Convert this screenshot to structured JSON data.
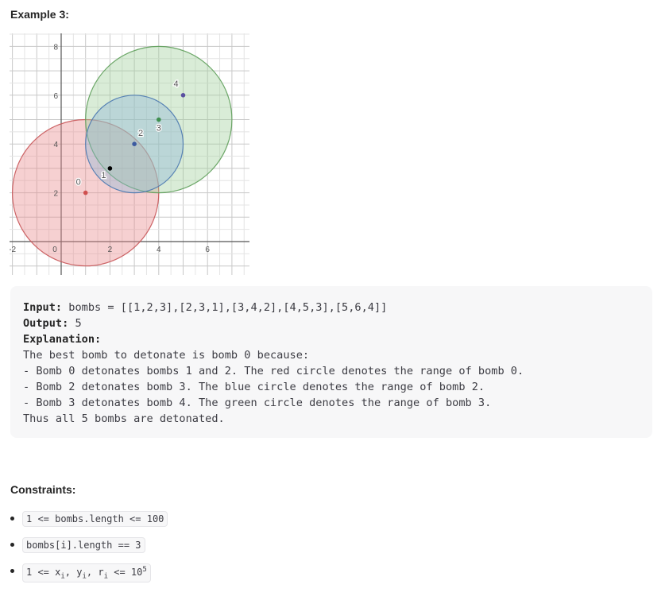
{
  "example": {
    "heading": "Example 3:",
    "input_label": "Input:",
    "input_value": " bombs = [[1,2,3],[2,3,1],[3,4,2],[4,5,3],[5,6,4]]",
    "output_label": "Output:",
    "output_value": " 5",
    "explanation_label": "Explanation:",
    "explanation_lines": [
      "The best bomb to detonate is bomb 0 because:",
      "- Bomb 0 detonates bombs 1 and 2. The red circle denotes the range of bomb 0.",
      "- Bomb 2 detonates bomb 3. The blue circle denotes the range of bomb 2.",
      "- Bomb 3 detonates bomb 4. The green circle denotes the range of bomb 3.",
      "Thus all 5 bombs are detonated."
    ]
  },
  "constraints": {
    "heading": "Constraints:",
    "items": [
      "1 <= bombs.length <= 100",
      "bombs[i].length == 3"
    ],
    "item3": {
      "pre": "1 <= x",
      "s1": "i",
      "mid1": ", y",
      "s2": "i",
      "mid2": ", r",
      "s3": "i",
      "mid3": " <= 10",
      "sup": "5"
    }
  },
  "chart_data": {
    "type": "scatter",
    "xlim": [
      -2,
      7.5
    ],
    "ylim": [
      -1.3,
      8.5
    ],
    "x_ticks": [
      "-2",
      "0",
      "2",
      "4",
      "6"
    ],
    "y_ticks": [
      "2",
      "4",
      "6",
      "8"
    ],
    "grid": true,
    "bombs": [
      {
        "label": "0",
        "x": 1,
        "y": 2,
        "r": 3,
        "color": "#d0504f"
      },
      {
        "label": "1",
        "x": 2,
        "y": 3,
        "r": 1,
        "color": "#000000"
      },
      {
        "label": "2",
        "x": 3,
        "y": 4,
        "r": 2,
        "color": "#3c5aa0"
      },
      {
        "label": "3",
        "x": 4,
        "y": 5,
        "r": 3,
        "color": "#3f8f4f"
      },
      {
        "label": "4",
        "x": 5,
        "y": 6,
        "r": 4,
        "color": "#5a4fa0"
      }
    ],
    "circles": [
      {
        "of_bomb": "0",
        "fill": "#e8898c",
        "stroke": "#c85558"
      },
      {
        "of_bomb": "3",
        "fill": "#9fcf9c",
        "stroke": "#5e9e5a"
      },
      {
        "of_bomb": "2",
        "fill": "#8fb6d8",
        "stroke": "#4a78b0"
      }
    ]
  }
}
